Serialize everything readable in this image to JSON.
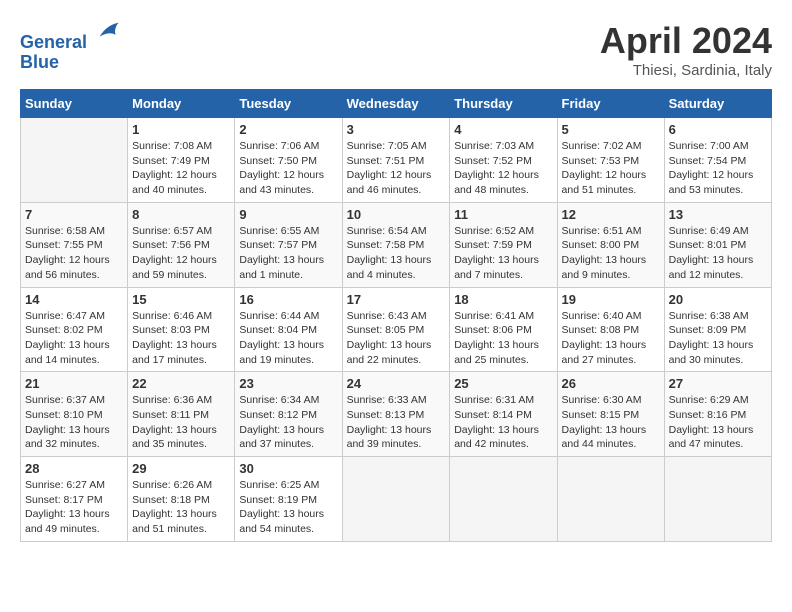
{
  "header": {
    "logo_line1": "General",
    "logo_line2": "Blue",
    "month": "April 2024",
    "location": "Thiesi, Sardinia, Italy"
  },
  "weekdays": [
    "Sunday",
    "Monday",
    "Tuesday",
    "Wednesday",
    "Thursday",
    "Friday",
    "Saturday"
  ],
  "weeks": [
    [
      {
        "day": "",
        "sunrise": "",
        "sunset": "",
        "daylight": ""
      },
      {
        "day": "1",
        "sunrise": "Sunrise: 7:08 AM",
        "sunset": "Sunset: 7:49 PM",
        "daylight": "Daylight: 12 hours and 40 minutes."
      },
      {
        "day": "2",
        "sunrise": "Sunrise: 7:06 AM",
        "sunset": "Sunset: 7:50 PM",
        "daylight": "Daylight: 12 hours and 43 minutes."
      },
      {
        "day": "3",
        "sunrise": "Sunrise: 7:05 AM",
        "sunset": "Sunset: 7:51 PM",
        "daylight": "Daylight: 12 hours and 46 minutes."
      },
      {
        "day": "4",
        "sunrise": "Sunrise: 7:03 AM",
        "sunset": "Sunset: 7:52 PM",
        "daylight": "Daylight: 12 hours and 48 minutes."
      },
      {
        "day": "5",
        "sunrise": "Sunrise: 7:02 AM",
        "sunset": "Sunset: 7:53 PM",
        "daylight": "Daylight: 12 hours and 51 minutes."
      },
      {
        "day": "6",
        "sunrise": "Sunrise: 7:00 AM",
        "sunset": "Sunset: 7:54 PM",
        "daylight": "Daylight: 12 hours and 53 minutes."
      }
    ],
    [
      {
        "day": "7",
        "sunrise": "Sunrise: 6:58 AM",
        "sunset": "Sunset: 7:55 PM",
        "daylight": "Daylight: 12 hours and 56 minutes."
      },
      {
        "day": "8",
        "sunrise": "Sunrise: 6:57 AM",
        "sunset": "Sunset: 7:56 PM",
        "daylight": "Daylight: 12 hours and 59 minutes."
      },
      {
        "day": "9",
        "sunrise": "Sunrise: 6:55 AM",
        "sunset": "Sunset: 7:57 PM",
        "daylight": "Daylight: 13 hours and 1 minute."
      },
      {
        "day": "10",
        "sunrise": "Sunrise: 6:54 AM",
        "sunset": "Sunset: 7:58 PM",
        "daylight": "Daylight: 13 hours and 4 minutes."
      },
      {
        "day": "11",
        "sunrise": "Sunrise: 6:52 AM",
        "sunset": "Sunset: 7:59 PM",
        "daylight": "Daylight: 13 hours and 7 minutes."
      },
      {
        "day": "12",
        "sunrise": "Sunrise: 6:51 AM",
        "sunset": "Sunset: 8:00 PM",
        "daylight": "Daylight: 13 hours and 9 minutes."
      },
      {
        "day": "13",
        "sunrise": "Sunrise: 6:49 AM",
        "sunset": "Sunset: 8:01 PM",
        "daylight": "Daylight: 13 hours and 12 minutes."
      }
    ],
    [
      {
        "day": "14",
        "sunrise": "Sunrise: 6:47 AM",
        "sunset": "Sunset: 8:02 PM",
        "daylight": "Daylight: 13 hours and 14 minutes."
      },
      {
        "day": "15",
        "sunrise": "Sunrise: 6:46 AM",
        "sunset": "Sunset: 8:03 PM",
        "daylight": "Daylight: 13 hours and 17 minutes."
      },
      {
        "day": "16",
        "sunrise": "Sunrise: 6:44 AM",
        "sunset": "Sunset: 8:04 PM",
        "daylight": "Daylight: 13 hours and 19 minutes."
      },
      {
        "day": "17",
        "sunrise": "Sunrise: 6:43 AM",
        "sunset": "Sunset: 8:05 PM",
        "daylight": "Daylight: 13 hours and 22 minutes."
      },
      {
        "day": "18",
        "sunrise": "Sunrise: 6:41 AM",
        "sunset": "Sunset: 8:06 PM",
        "daylight": "Daylight: 13 hours and 25 minutes."
      },
      {
        "day": "19",
        "sunrise": "Sunrise: 6:40 AM",
        "sunset": "Sunset: 8:08 PM",
        "daylight": "Daylight: 13 hours and 27 minutes."
      },
      {
        "day": "20",
        "sunrise": "Sunrise: 6:38 AM",
        "sunset": "Sunset: 8:09 PM",
        "daylight": "Daylight: 13 hours and 30 minutes."
      }
    ],
    [
      {
        "day": "21",
        "sunrise": "Sunrise: 6:37 AM",
        "sunset": "Sunset: 8:10 PM",
        "daylight": "Daylight: 13 hours and 32 minutes."
      },
      {
        "day": "22",
        "sunrise": "Sunrise: 6:36 AM",
        "sunset": "Sunset: 8:11 PM",
        "daylight": "Daylight: 13 hours and 35 minutes."
      },
      {
        "day": "23",
        "sunrise": "Sunrise: 6:34 AM",
        "sunset": "Sunset: 8:12 PM",
        "daylight": "Daylight: 13 hours and 37 minutes."
      },
      {
        "day": "24",
        "sunrise": "Sunrise: 6:33 AM",
        "sunset": "Sunset: 8:13 PM",
        "daylight": "Daylight: 13 hours and 39 minutes."
      },
      {
        "day": "25",
        "sunrise": "Sunrise: 6:31 AM",
        "sunset": "Sunset: 8:14 PM",
        "daylight": "Daylight: 13 hours and 42 minutes."
      },
      {
        "day": "26",
        "sunrise": "Sunrise: 6:30 AM",
        "sunset": "Sunset: 8:15 PM",
        "daylight": "Daylight: 13 hours and 44 minutes."
      },
      {
        "day": "27",
        "sunrise": "Sunrise: 6:29 AM",
        "sunset": "Sunset: 8:16 PM",
        "daylight": "Daylight: 13 hours and 47 minutes."
      }
    ],
    [
      {
        "day": "28",
        "sunrise": "Sunrise: 6:27 AM",
        "sunset": "Sunset: 8:17 PM",
        "daylight": "Daylight: 13 hours and 49 minutes."
      },
      {
        "day": "29",
        "sunrise": "Sunrise: 6:26 AM",
        "sunset": "Sunset: 8:18 PM",
        "daylight": "Daylight: 13 hours and 51 minutes."
      },
      {
        "day": "30",
        "sunrise": "Sunrise: 6:25 AM",
        "sunset": "Sunset: 8:19 PM",
        "daylight": "Daylight: 13 hours and 54 minutes."
      },
      {
        "day": "",
        "sunrise": "",
        "sunset": "",
        "daylight": ""
      },
      {
        "day": "",
        "sunrise": "",
        "sunset": "",
        "daylight": ""
      },
      {
        "day": "",
        "sunrise": "",
        "sunset": "",
        "daylight": ""
      },
      {
        "day": "",
        "sunrise": "",
        "sunset": "",
        "daylight": ""
      }
    ]
  ]
}
